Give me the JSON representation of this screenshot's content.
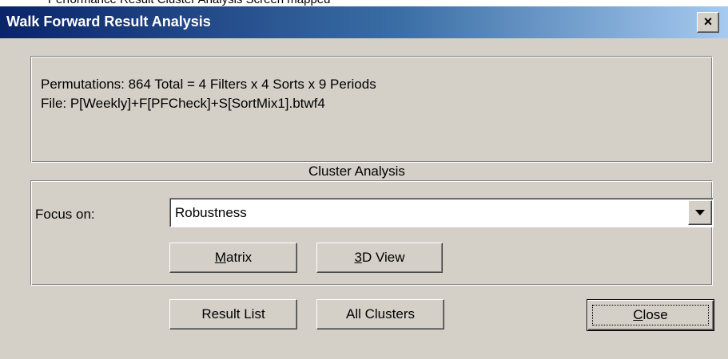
{
  "background_caption": "Performance Result Cluster Analysis Screen mapped",
  "window": {
    "title": "Walk Forward Result Analysis",
    "close_glyph": "×"
  },
  "info": {
    "permutations": "Permutations: 864 Total = 4 Filters x 4 Sorts x 9 Periods",
    "file": "File: P[Weekly]+F[PFCheck]+S[SortMix1].btwf4"
  },
  "cluster_analysis": {
    "group_label": "Cluster Analysis",
    "focus_label": "Focus on:",
    "focus_value": "Robustness",
    "matrix_button": {
      "mnemonic": "M",
      "rest": "atrix"
    },
    "view3d_button": {
      "mnemonic": "3",
      "rest": "D View"
    }
  },
  "footer": {
    "result_list_button": "Result List",
    "all_clusters_button": "All Clusters",
    "close_button": {
      "mnemonic": "C",
      "rest": "lose"
    }
  },
  "colors": {
    "title_gradient_start": "#0a246a",
    "title_gradient_end": "#a6caf0",
    "dialog_face": "#d4d0c8"
  },
  "icons": {
    "dropdown": "chevron-down-icon",
    "close": "close-icon"
  }
}
